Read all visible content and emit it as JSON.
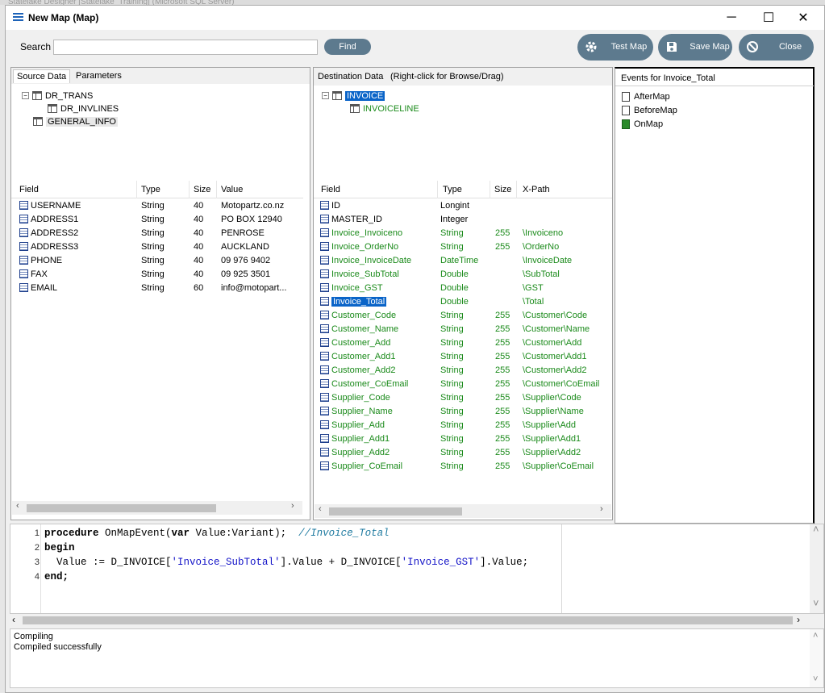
{
  "background": {
    "title": "Statelake Designer [Statelake_Training] (Microsoft SQL Server)"
  },
  "window": {
    "title": "New Map (Map)",
    "minimize": "─",
    "maximize": "☐",
    "close": "✕"
  },
  "search": {
    "label": "Search",
    "value": "",
    "placeholder": "",
    "find_label": "Find"
  },
  "toolbar": {
    "test_map": "Test Map",
    "save_map": "Save Map",
    "close": "Close"
  },
  "source": {
    "tabs": [
      "Source Data",
      "Parameters"
    ],
    "tree": [
      {
        "label": "DR_TRANS",
        "level": 0,
        "expanded": true
      },
      {
        "label": "DR_INVLINES",
        "level": 1
      },
      {
        "label": "GENERAL_INFO",
        "level": 0
      }
    ],
    "columns": [
      "Field",
      "Type",
      "Size",
      "Value"
    ],
    "rows": [
      {
        "field": "USERNAME",
        "type": "String",
        "size": "40",
        "value": "Motopartz.co.nz"
      },
      {
        "field": "ADDRESS1",
        "type": "String",
        "size": "40",
        "value": "PO BOX 12940"
      },
      {
        "field": "ADDRESS2",
        "type": "String",
        "size": "40",
        "value": "PENROSE"
      },
      {
        "field": "ADDRESS3",
        "type": "String",
        "size": "40",
        "value": "AUCKLAND"
      },
      {
        "field": "PHONE",
        "type": "String",
        "size": "40",
        "value": "09 976 9402"
      },
      {
        "field": "FAX",
        "type": "String",
        "size": "40",
        "value": "09 925 3501"
      },
      {
        "field": "EMAIL",
        "type": "String",
        "size": "60",
        "value": "info@motopart..."
      }
    ]
  },
  "destination": {
    "header": "Destination Data",
    "hint": "(Right-click for Browse/Drag)",
    "tree": [
      {
        "label": "INVOICE",
        "selected": true
      },
      {
        "label": "INVOICELINE"
      }
    ],
    "columns": [
      "Field",
      "Type",
      "Size",
      "X-Path"
    ],
    "rows": [
      {
        "field": "ID",
        "type": "Longint",
        "size": "",
        "xpath": "",
        "green": false
      },
      {
        "field": "MASTER_ID",
        "type": "Integer",
        "size": "",
        "xpath": "",
        "green": false
      },
      {
        "field": "Invoice_Invoiceno",
        "type": "String",
        "size": "255",
        "xpath": "\\Invoiceno",
        "green": true
      },
      {
        "field": "Invoice_OrderNo",
        "type": "String",
        "size": "255",
        "xpath": "\\OrderNo",
        "green": true
      },
      {
        "field": "Invoice_InvoiceDate",
        "type": "DateTime",
        "size": "",
        "xpath": "\\InvoiceDate",
        "green": true
      },
      {
        "field": "Invoice_SubTotal",
        "type": "Double",
        "size": "",
        "xpath": "\\SubTotal",
        "green": true
      },
      {
        "field": "Invoice_GST",
        "type": "Double",
        "size": "",
        "xpath": "\\GST",
        "green": true
      },
      {
        "field": "Invoice_Total",
        "type": "Double",
        "size": "",
        "xpath": "\\Total",
        "green": true,
        "selected": true
      },
      {
        "field": "Customer_Code",
        "type": "String",
        "size": "255",
        "xpath": "\\Customer\\Code",
        "green": true
      },
      {
        "field": "Customer_Name",
        "type": "String",
        "size": "255",
        "xpath": "\\Customer\\Name",
        "green": true
      },
      {
        "field": "Customer_Add",
        "type": "String",
        "size": "255",
        "xpath": "\\Customer\\Add",
        "green": true
      },
      {
        "field": "Customer_Add1",
        "type": "String",
        "size": "255",
        "xpath": "\\Customer\\Add1",
        "green": true
      },
      {
        "field": "Customer_Add2",
        "type": "String",
        "size": "255",
        "xpath": "\\Customer\\Add2",
        "green": true
      },
      {
        "field": "Customer_CoEmail",
        "type": "String",
        "size": "255",
        "xpath": "\\Customer\\CoEmail",
        "green": true
      },
      {
        "field": "Supplier_Code",
        "type": "String",
        "size": "255",
        "xpath": "\\Supplier\\Code",
        "green": true
      },
      {
        "field": "Supplier_Name",
        "type": "String",
        "size": "255",
        "xpath": "\\Supplier\\Name",
        "green": true
      },
      {
        "field": "Supplier_Add",
        "type": "String",
        "size": "255",
        "xpath": "\\Supplier\\Add",
        "green": true
      },
      {
        "field": "Supplier_Add1",
        "type": "String",
        "size": "255",
        "xpath": "\\Supplier\\Add1",
        "green": true
      },
      {
        "field": "Supplier_Add2",
        "type": "String",
        "size": "255",
        "xpath": "\\Supplier\\Add2",
        "green": true
      },
      {
        "field": "Supplier_CoEmail",
        "type": "String",
        "size": "255",
        "xpath": "\\Supplier\\CoEmail",
        "green": true
      }
    ]
  },
  "events": {
    "header": "Events for Invoice_Total",
    "items": [
      {
        "label": "AfterMap",
        "active": false
      },
      {
        "label": "BeforeMap",
        "active": false
      },
      {
        "label": "OnMap",
        "active": true
      }
    ]
  },
  "code": {
    "lines": [
      [
        {
          "t": "procedure",
          "c": "kw"
        },
        {
          "t": " OnMapEvent(",
          "c": ""
        },
        {
          "t": "var",
          "c": "kw"
        },
        {
          "t": " Value:Variant);  ",
          "c": ""
        },
        {
          "t": "//Invoice_Total",
          "c": "cm"
        }
      ],
      [
        {
          "t": "begin",
          "c": "kw"
        }
      ],
      [
        {
          "t": "  Value := D_INVOICE[",
          "c": ""
        },
        {
          "t": "'Invoice_SubTotal'",
          "c": "str"
        },
        {
          "t": "].Value + D_INVOICE[",
          "c": ""
        },
        {
          "t": "'Invoice_GST'",
          "c": "str"
        },
        {
          "t": "].Value;",
          "c": ""
        }
      ],
      [
        {
          "t": "end;",
          "c": "kw"
        }
      ]
    ]
  },
  "output": {
    "lines": [
      "Compiling",
      "Compiled successfully"
    ]
  },
  "colors": {
    "button": "#5d7a8e",
    "selection": "#0a64c8",
    "mapped": "#1a8a1a"
  }
}
